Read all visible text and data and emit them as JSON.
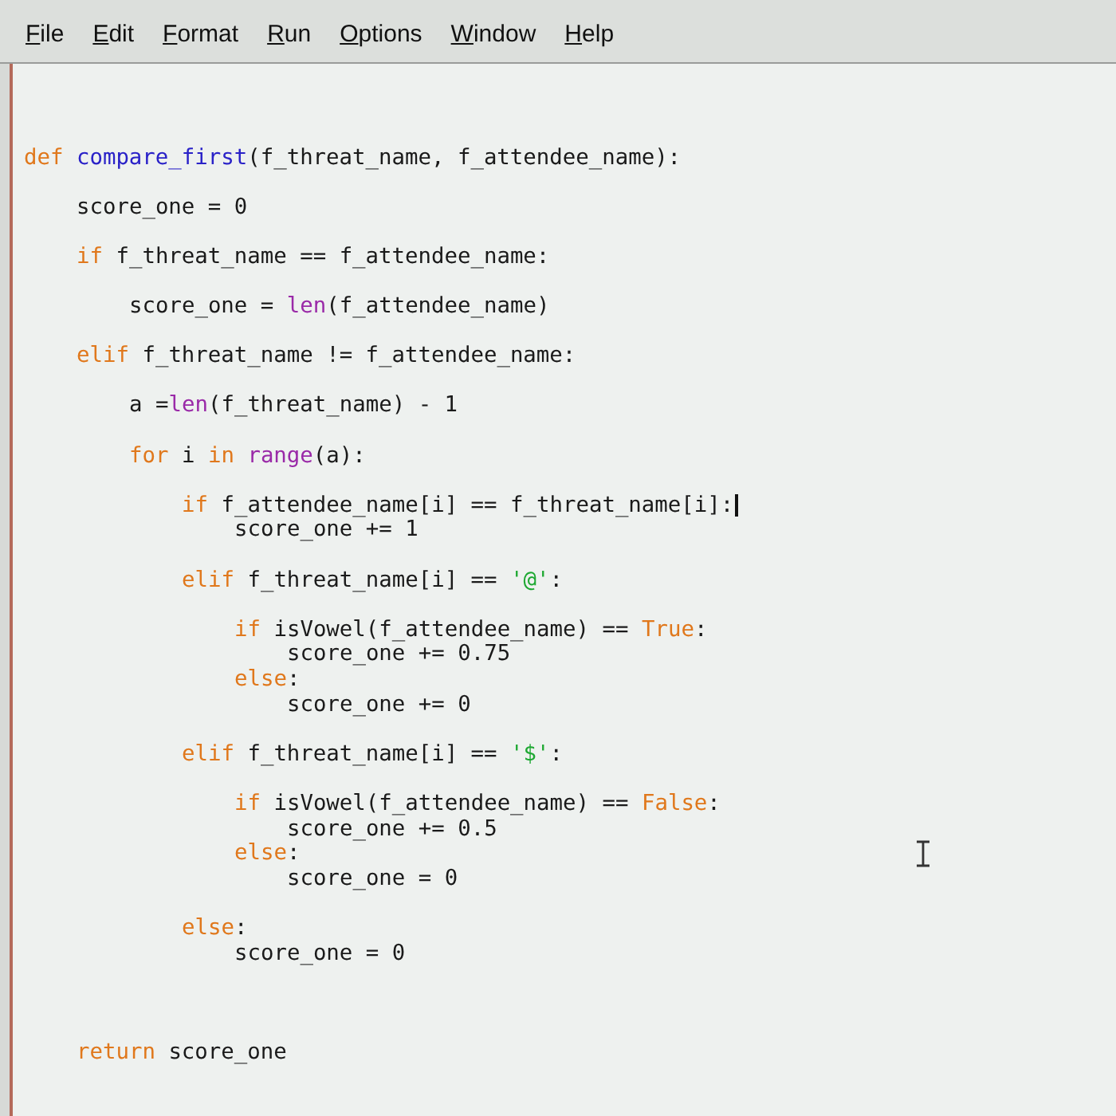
{
  "menu_bar": [
    {
      "label": "File"
    },
    {
      "label": "Edit"
    },
    {
      "label": "Format"
    },
    {
      "label": "Run"
    },
    {
      "label": "Options"
    },
    {
      "label": "Window"
    },
    {
      "label": "Help"
    }
  ],
  "editor": {
    "lines": [
      {
        "kind": "code",
        "tokens": [
          {
            "kind": "keyword",
            "text": "def "
          },
          {
            "kind": "defname",
            "text": "compare_first"
          },
          {
            "kind": "plain",
            "text": "(f_threat_name, f_attendee_name):"
          }
        ],
        "children": [
          {
            "kind": "blank"
          },
          {
            "kind": "code",
            "tokens": [
              {
                "kind": "plain",
                "text": "score_one = 0"
              }
            ]
          },
          {
            "kind": "blank"
          },
          {
            "kind": "code",
            "tokens": [
              {
                "kind": "keyword",
                "text": "if"
              },
              {
                "kind": "plain",
                "text": " f_threat_name == f_attendee_name:"
              }
            ],
            "children": [
              {
                "kind": "blank"
              },
              {
                "kind": "code",
                "tokens": [
                  {
                    "kind": "plain",
                    "text": "score_one = "
                  },
                  {
                    "kind": "builtin",
                    "text": "len"
                  },
                  {
                    "kind": "plain",
                    "text": "(f_attendee_name)"
                  }
                ]
              }
            ]
          },
          {
            "kind": "blank"
          },
          {
            "kind": "code",
            "tokens": [
              {
                "kind": "keyword",
                "text": "elif"
              },
              {
                "kind": "plain",
                "text": " f_threat_name != f_attendee_name:"
              }
            ],
            "children": [
              {
                "kind": "blank"
              },
              {
                "kind": "code",
                "tokens": [
                  {
                    "kind": "plain",
                    "text": "a ="
                  },
                  {
                    "kind": "builtin",
                    "text": "len"
                  },
                  {
                    "kind": "plain",
                    "text": "(f_threat_name) - 1"
                  }
                ]
              },
              {
                "kind": "blank"
              },
              {
                "kind": "code",
                "tokens": [
                  {
                    "kind": "keyword",
                    "text": "for"
                  },
                  {
                    "kind": "plain",
                    "text": " i "
                  },
                  {
                    "kind": "keyword",
                    "text": "in "
                  },
                  {
                    "kind": "builtin",
                    "text": "range"
                  },
                  {
                    "kind": "plain",
                    "text": "(a):"
                  }
                ],
                "children": [
                  {
                    "kind": "blank"
                  },
                  {
                    "kind": "code",
                    "caret": true,
                    "tokens": [
                      {
                        "kind": "keyword",
                        "text": "if"
                      },
                      {
                        "kind": "plain",
                        "text": " f_attendee_name[i] == f_threat_name[i]:"
                      }
                    ],
                    "children": [
                      {
                        "kind": "code",
                        "tokens": [
                          {
                            "kind": "plain",
                            "text": "score_one += 1"
                          }
                        ]
                      }
                    ]
                  },
                  {
                    "kind": "blank"
                  },
                  {
                    "kind": "code",
                    "tokens": [
                      {
                        "kind": "keyword",
                        "text": "elif"
                      },
                      {
                        "kind": "plain",
                        "text": " f_threat_name[i] == "
                      },
                      {
                        "kind": "string",
                        "text": "'@'"
                      },
                      {
                        "kind": "plain",
                        "text": ":"
                      }
                    ],
                    "children": [
                      {
                        "kind": "blank"
                      },
                      {
                        "kind": "code",
                        "tokens": [
                          {
                            "kind": "keyword",
                            "text": "if"
                          },
                          {
                            "kind": "plain",
                            "text": " isVowel(f_attendee_name) == "
                          },
                          {
                            "kind": "keyword",
                            "text": "True"
                          },
                          {
                            "kind": "plain",
                            "text": ":"
                          }
                        ],
                        "children": [
                          {
                            "kind": "code",
                            "tokens": [
                              {
                                "kind": "plain",
                                "text": "score_one += 0.75"
                              }
                            ]
                          }
                        ]
                      },
                      {
                        "kind": "code",
                        "tokens": [
                          {
                            "kind": "keyword",
                            "text": "else"
                          },
                          {
                            "kind": "plain",
                            "text": ":"
                          }
                        ],
                        "children": [
                          {
                            "kind": "code",
                            "tokens": [
                              {
                                "kind": "plain",
                                "text": "score_one += 0"
                              }
                            ]
                          }
                        ]
                      }
                    ]
                  },
                  {
                    "kind": "blank"
                  },
                  {
                    "kind": "code",
                    "tokens": [
                      {
                        "kind": "keyword",
                        "text": "elif"
                      },
                      {
                        "kind": "plain",
                        "text": " f_threat_name[i] == "
                      },
                      {
                        "kind": "string",
                        "text": "'$'"
                      },
                      {
                        "kind": "plain",
                        "text": ":"
                      }
                    ],
                    "children": [
                      {
                        "kind": "blank"
                      },
                      {
                        "kind": "code",
                        "tokens": [
                          {
                            "kind": "keyword",
                            "text": "if"
                          },
                          {
                            "kind": "plain",
                            "text": " isVowel(f_attendee_name) == "
                          },
                          {
                            "kind": "keyword",
                            "text": "False"
                          },
                          {
                            "kind": "plain",
                            "text": ":"
                          }
                        ],
                        "children": [
                          {
                            "kind": "code",
                            "tokens": [
                              {
                                "kind": "plain",
                                "text": "score_one += 0.5"
                              }
                            ]
                          }
                        ]
                      },
                      {
                        "kind": "code",
                        "tokens": [
                          {
                            "kind": "keyword",
                            "text": "else"
                          },
                          {
                            "kind": "plain",
                            "text": ":"
                          }
                        ],
                        "children": [
                          {
                            "kind": "code",
                            "tokens": [
                              {
                                "kind": "plain",
                                "text": "score_one = 0"
                              }
                            ]
                          }
                        ]
                      }
                    ]
                  },
                  {
                    "kind": "blank"
                  },
                  {
                    "kind": "code",
                    "tokens": [
                      {
                        "kind": "keyword",
                        "text": "else"
                      },
                      {
                        "kind": "plain",
                        "text": ":"
                      }
                    ],
                    "children": [
                      {
                        "kind": "code",
                        "tokens": [
                          {
                            "kind": "plain",
                            "text": "score_one = 0"
                          }
                        ]
                      }
                    ]
                  }
                ]
              }
            ]
          },
          {
            "kind": "blank"
          },
          {
            "kind": "blank"
          },
          {
            "kind": "blank"
          },
          {
            "kind": "code",
            "tokens": [
              {
                "kind": "keyword",
                "text": "return"
              },
              {
                "kind": "plain",
                "text": " score_one"
              }
            ]
          }
        ]
      }
    ]
  },
  "mouse_pointer": true
}
